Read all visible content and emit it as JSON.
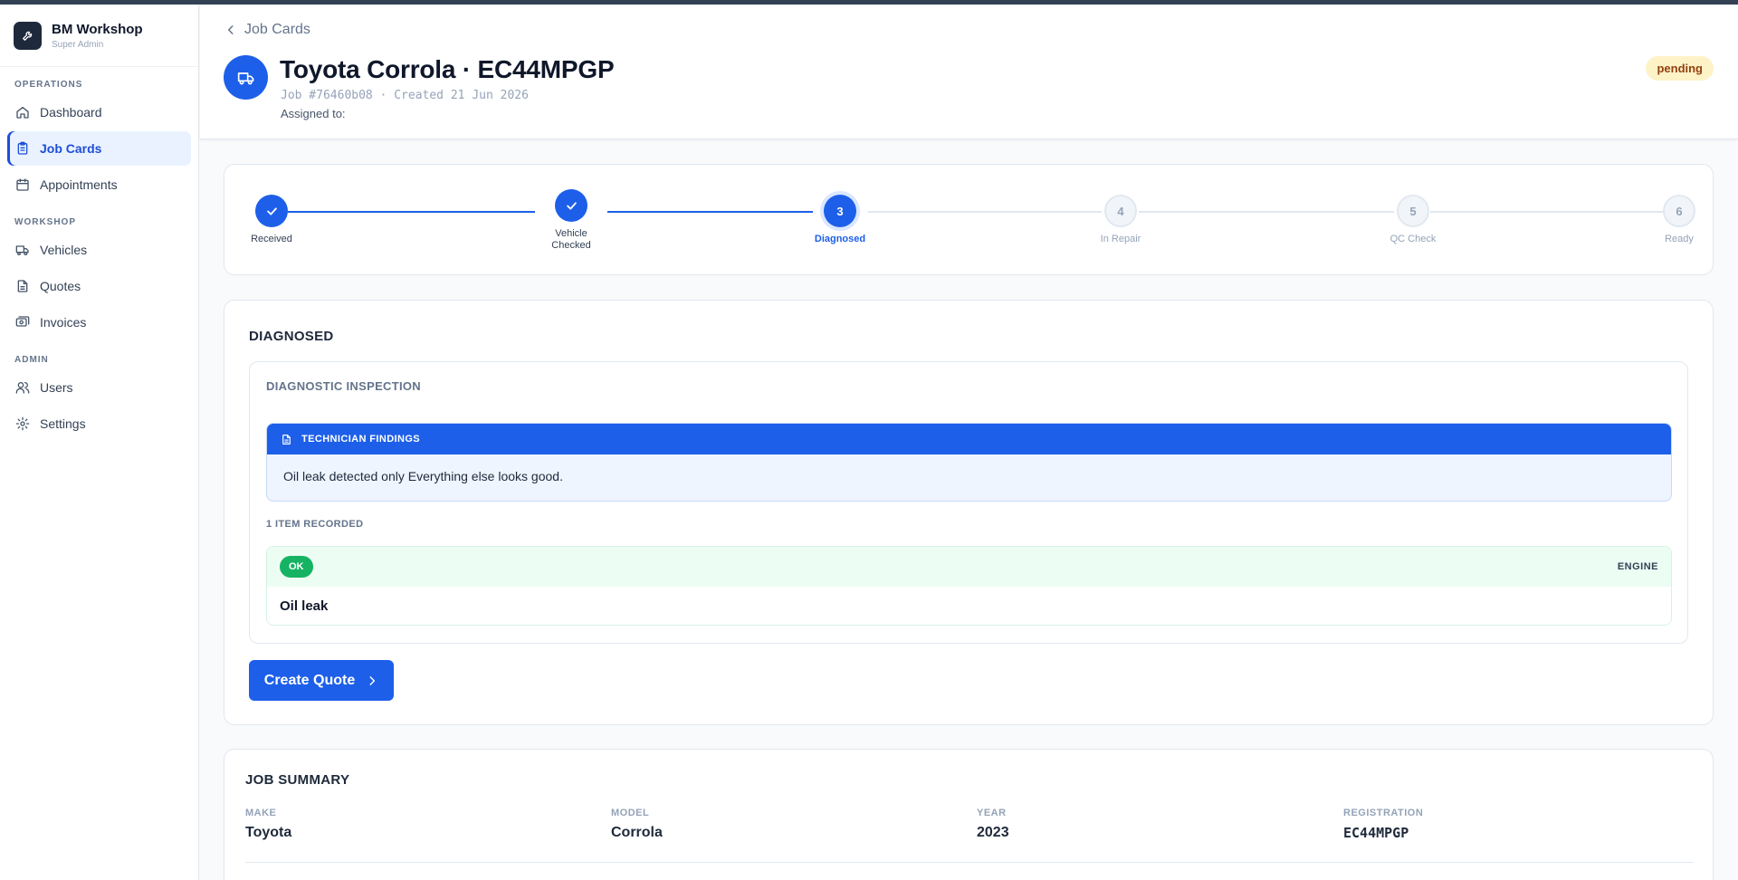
{
  "sidebar": {
    "brand": {
      "name": "BM Workshop",
      "role": "Super Admin"
    },
    "sections": [
      {
        "title": "OPERATIONS"
      },
      {
        "title": "WORKSHOP"
      },
      {
        "title": "ADMIN"
      }
    ],
    "items": [
      {
        "label": "Dashboard",
        "icon": "home-icon"
      },
      {
        "label": "Job Cards",
        "icon": "clipboard-icon",
        "active": true
      },
      {
        "label": "Appointments",
        "icon": "calendar-icon"
      },
      {
        "label": "Vehicles",
        "icon": "truck-icon"
      },
      {
        "label": "Quotes",
        "icon": "document-icon"
      },
      {
        "label": "Invoices",
        "icon": "receipt-icon"
      },
      {
        "label": "Users",
        "icon": "users-icon"
      },
      {
        "label": "Settings",
        "icon": "gear-icon"
      }
    ]
  },
  "header": {
    "breadcrumb": "Job Cards",
    "title": "Toyota Corrola · EC44MPGP",
    "meta": "Job #76460b08 · Created 21 Jun 2026",
    "assigned": "Assigned to:",
    "status": "pending"
  },
  "stepper": {
    "steps": [
      {
        "label": "Received",
        "state": "done"
      },
      {
        "label": "Vehicle Checked",
        "state": "done"
      },
      {
        "label": "Diagnosed",
        "number": "3",
        "state": "current"
      },
      {
        "label": "In Repair",
        "number": "4",
        "state": "todo"
      },
      {
        "label": "QC Check",
        "number": "5",
        "state": "todo"
      },
      {
        "label": "Ready",
        "number": "6",
        "state": "todo"
      }
    ]
  },
  "diagnosed": {
    "title": "DIAGNOSED",
    "inspection_title": "DIAGNOSTIC INSPECTION",
    "findings_title": "TECHNICIAN FINDINGS",
    "findings_text": "Oil leak detected only Everything else looks good.",
    "items_count": "1 ITEM RECORDED",
    "items": [
      {
        "status": "OK",
        "category": "ENGINE",
        "name": "Oil leak"
      }
    ],
    "button_label": "Create Quote"
  },
  "summary": {
    "title": "JOB SUMMARY",
    "fields": [
      {
        "label": "MAKE",
        "value": "Toyota"
      },
      {
        "label": "MODEL",
        "value": "Corrola"
      },
      {
        "label": "YEAR",
        "value": "2023"
      },
      {
        "label": "REGISTRATION",
        "value": "EC44MPGP"
      }
    ]
  },
  "colors": {
    "primary": "#1d5fe8",
    "success": "#16b364",
    "pending_bg": "#fef3c7",
    "pending_text": "#92400e"
  }
}
